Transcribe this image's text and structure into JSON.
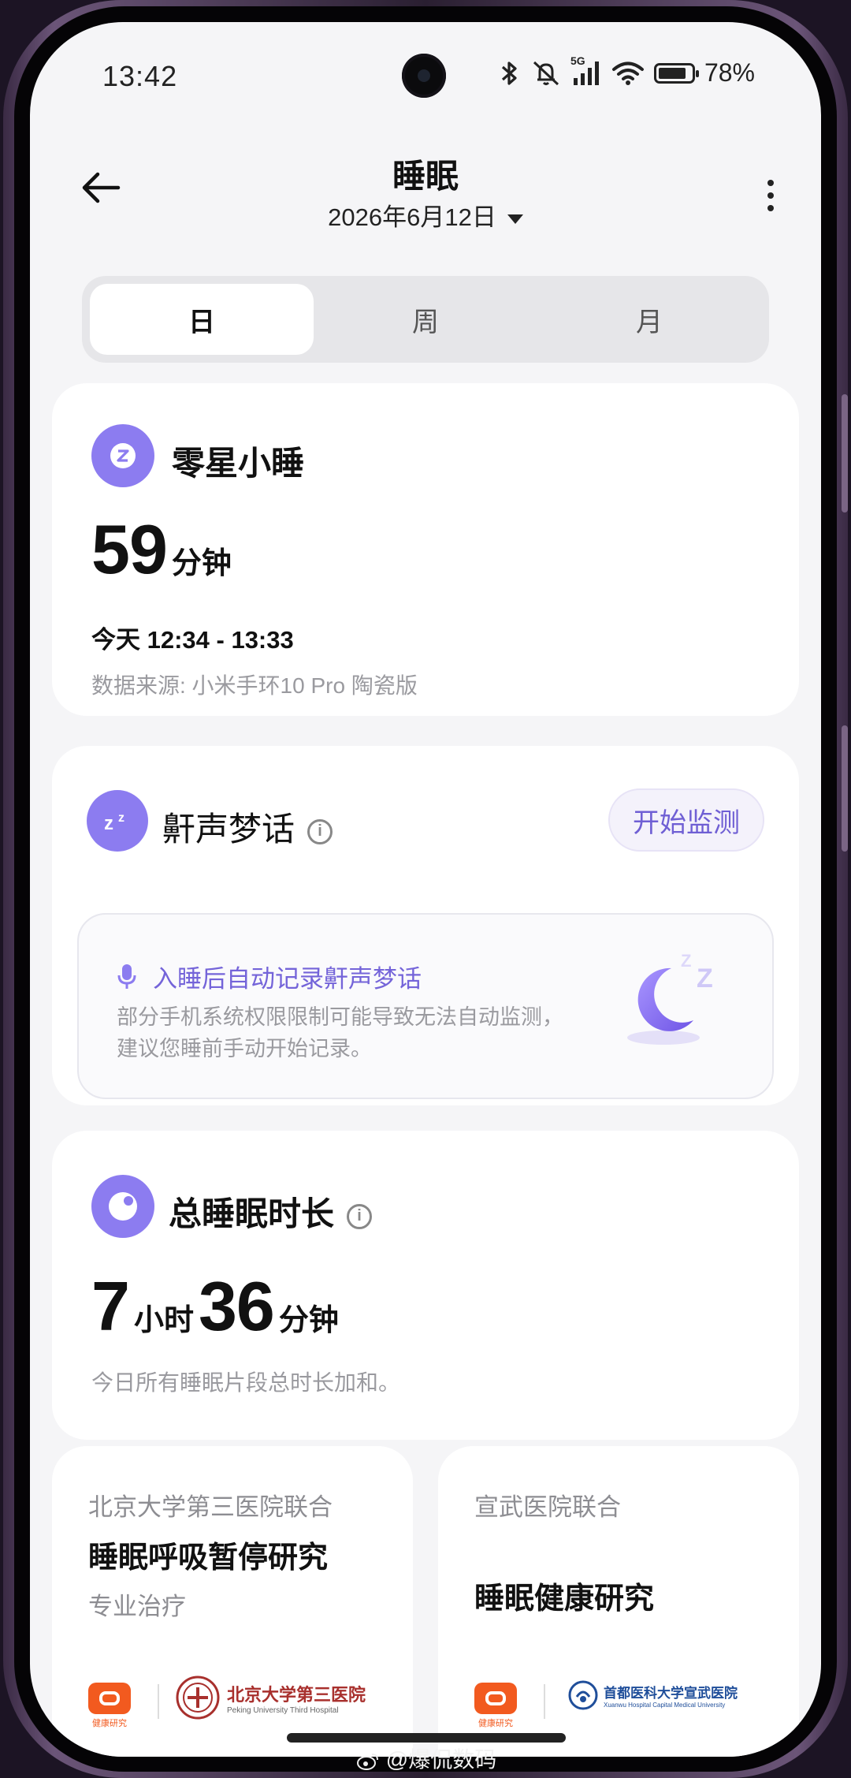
{
  "status_bar": {
    "time": "13:42",
    "network": "5G",
    "battery": "78%"
  },
  "header": {
    "title": "睡眠",
    "date": "2026年6月12日"
  },
  "tabs": [
    {
      "label": "日",
      "active": true
    },
    {
      "label": "周",
      "active": false
    },
    {
      "label": "月",
      "active": false
    }
  ],
  "nap_card": {
    "title": "零星小睡",
    "duration_value": "59",
    "duration_unit": "分钟",
    "time_range": "今天 12:34 - 13:33",
    "source": "数据来源: 小米手环10 Pro 陶瓷版"
  },
  "snore_card": {
    "title": "鼾声梦话",
    "button_label": "开始监测",
    "notice_title": "入睡后自动记录鼾声梦话",
    "notice_line1": "部分手机系统权限限制可能导致无法自动监测，",
    "notice_line2": "建议您睡前手动开始记录。"
  },
  "total_card": {
    "title": "总睡眠时长",
    "hours_value": "7",
    "hours_unit": "小时",
    "minutes_value": "36",
    "minutes_unit": "分钟",
    "note": "今日所有睡眠片段总时长加和。"
  },
  "study_cards": [
    {
      "partner": "北京大学第三医院联合",
      "title": "睡眠呼吸暂停研究",
      "subtitle": "专业治疗",
      "badge": "健康研究",
      "institution": "北京大学第三医院",
      "institution_en": "Peking University Third Hospital"
    },
    {
      "partner": "宣武医院联合",
      "title": "睡眠健康研究",
      "badge": "健康研究",
      "institution": "首都医科大学宣武医院",
      "institution_en": "Xuanwu Hospital Capital Medical University"
    }
  ],
  "watermark": "@爆侃数码",
  "colors": {
    "accent": "#8c7cf0",
    "badge_orange": "#f25a1f",
    "page_bg": "#f5f5f7"
  }
}
